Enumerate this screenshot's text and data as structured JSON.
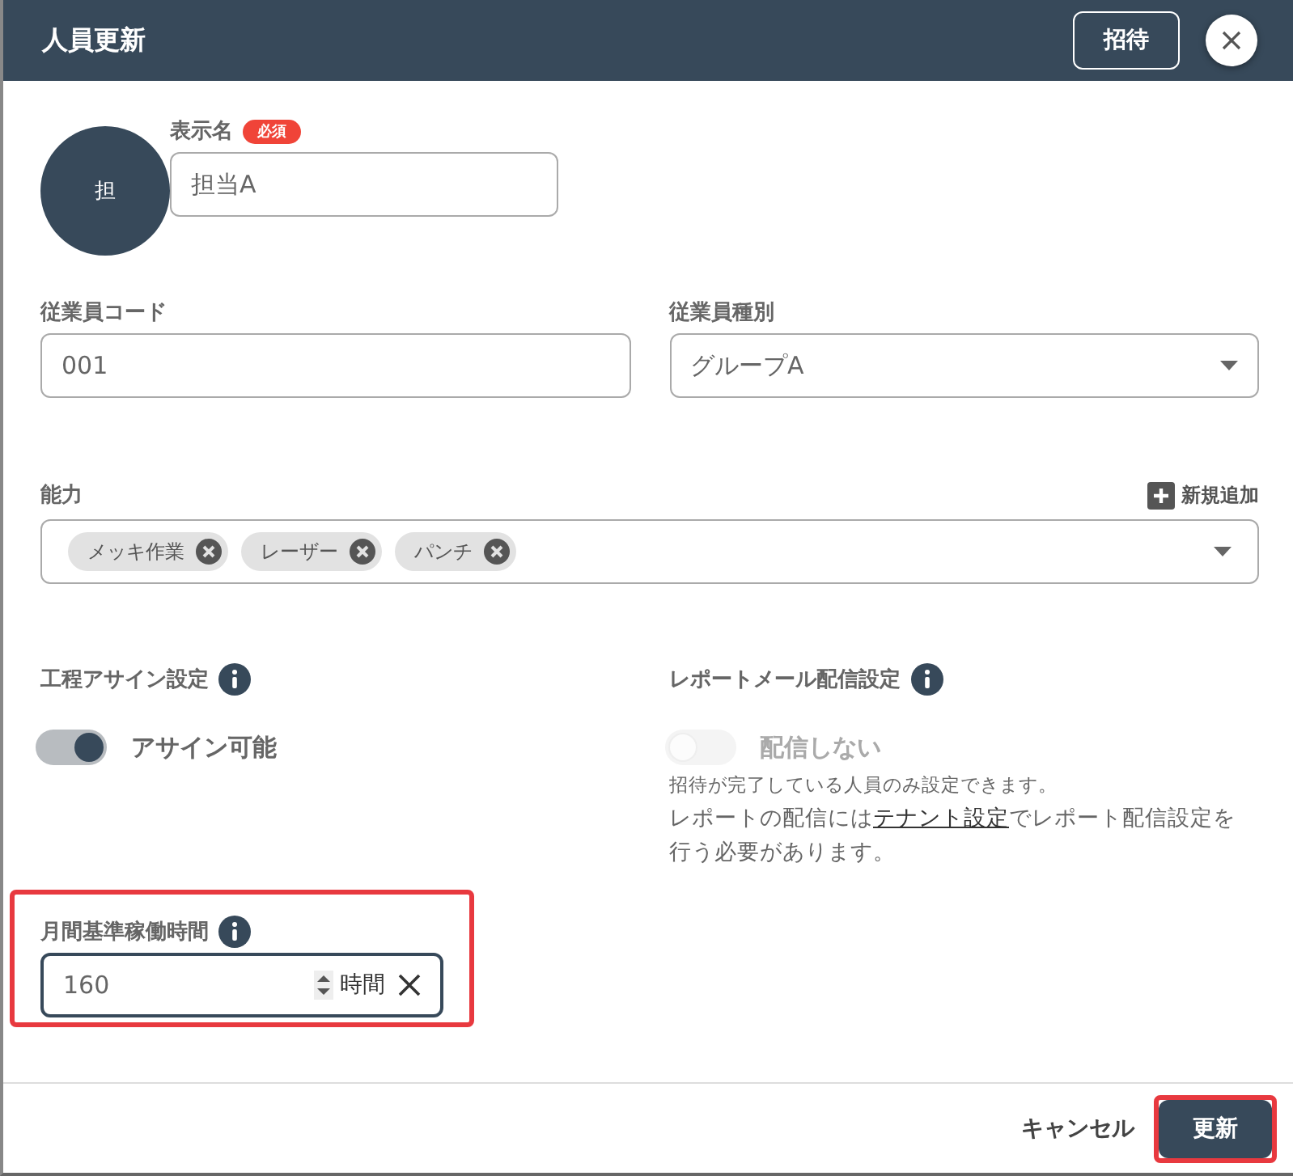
{
  "window": {
    "title": "人員更新"
  },
  "header_buttons": {
    "invite": "招待"
  },
  "avatar": {
    "initial": "担"
  },
  "display_name": {
    "label": "表示名",
    "badge": "必須",
    "value": "担当A"
  },
  "employee_code": {
    "label": "従業員コード",
    "value": "001"
  },
  "employee_type": {
    "label": "従業員種別",
    "value": "グループA"
  },
  "abilities": {
    "label": "能力",
    "add_label": "新規追加",
    "tags": [
      "メッキ作業",
      "レーザー",
      "パンチ"
    ]
  },
  "settings": [
    {
      "label": "工程アサイン設定",
      "toggle_label": "アサイン可能",
      "on": true,
      "disabled": false
    },
    {
      "label": "レポートメール配信設定",
      "toggle_label": "配信しない",
      "on": false,
      "disabled": true,
      "note": "招待が完了している人員のみ設定できます。",
      "link_note": {
        "before": "レポートの配信には",
        "link": "テナント設定",
        "after": "でレポート配信設定を行う必要があります。"
      }
    }
  ],
  "monthly_hours": {
    "label": "月間基準稼働時間",
    "value": "160",
    "unit": "時間",
    "highlighted": true
  },
  "footer": {
    "cancel": "キャンセル",
    "submit": "更新",
    "submit_highlighted": true
  }
}
